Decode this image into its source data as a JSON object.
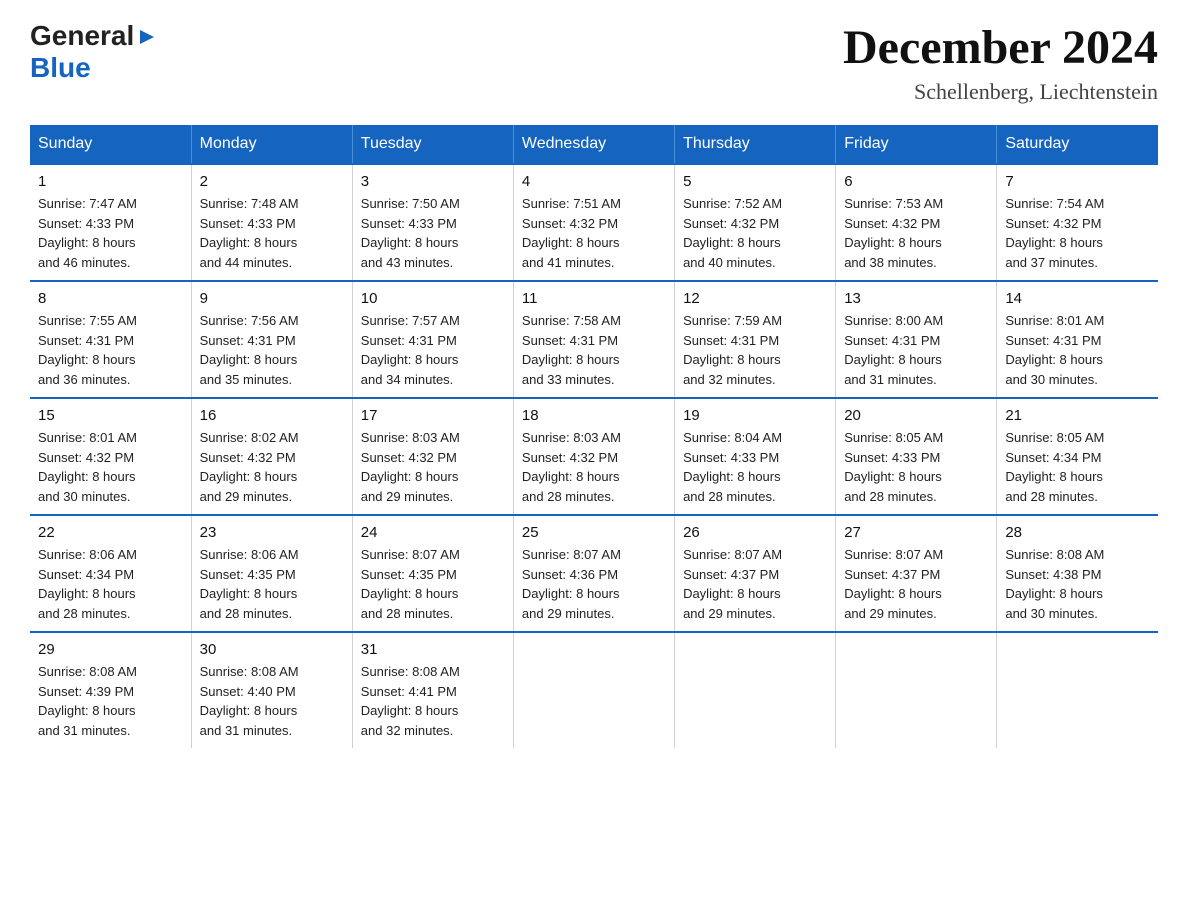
{
  "header": {
    "logo_general": "General",
    "logo_blue": "Blue",
    "month_title": "December 2024",
    "location": "Schellenberg, Liechtenstein"
  },
  "days_of_week": [
    "Sunday",
    "Monday",
    "Tuesday",
    "Wednesday",
    "Thursday",
    "Friday",
    "Saturday"
  ],
  "weeks": [
    [
      {
        "day": "1",
        "sunrise": "7:47 AM",
        "sunset": "4:33 PM",
        "daylight": "8 hours and 46 minutes."
      },
      {
        "day": "2",
        "sunrise": "7:48 AM",
        "sunset": "4:33 PM",
        "daylight": "8 hours and 44 minutes."
      },
      {
        "day": "3",
        "sunrise": "7:50 AM",
        "sunset": "4:33 PM",
        "daylight": "8 hours and 43 minutes."
      },
      {
        "day": "4",
        "sunrise": "7:51 AM",
        "sunset": "4:32 PM",
        "daylight": "8 hours and 41 minutes."
      },
      {
        "day": "5",
        "sunrise": "7:52 AM",
        "sunset": "4:32 PM",
        "daylight": "8 hours and 40 minutes."
      },
      {
        "day": "6",
        "sunrise": "7:53 AM",
        "sunset": "4:32 PM",
        "daylight": "8 hours and 38 minutes."
      },
      {
        "day": "7",
        "sunrise": "7:54 AM",
        "sunset": "4:32 PM",
        "daylight": "8 hours and 37 minutes."
      }
    ],
    [
      {
        "day": "8",
        "sunrise": "7:55 AM",
        "sunset": "4:31 PM",
        "daylight": "8 hours and 36 minutes."
      },
      {
        "day": "9",
        "sunrise": "7:56 AM",
        "sunset": "4:31 PM",
        "daylight": "8 hours and 35 minutes."
      },
      {
        "day": "10",
        "sunrise": "7:57 AM",
        "sunset": "4:31 PM",
        "daylight": "8 hours and 34 minutes."
      },
      {
        "day": "11",
        "sunrise": "7:58 AM",
        "sunset": "4:31 PM",
        "daylight": "8 hours and 33 minutes."
      },
      {
        "day": "12",
        "sunrise": "7:59 AM",
        "sunset": "4:31 PM",
        "daylight": "8 hours and 32 minutes."
      },
      {
        "day": "13",
        "sunrise": "8:00 AM",
        "sunset": "4:31 PM",
        "daylight": "8 hours and 31 minutes."
      },
      {
        "day": "14",
        "sunrise": "8:01 AM",
        "sunset": "4:31 PM",
        "daylight": "8 hours and 30 minutes."
      }
    ],
    [
      {
        "day": "15",
        "sunrise": "8:01 AM",
        "sunset": "4:32 PM",
        "daylight": "8 hours and 30 minutes."
      },
      {
        "day": "16",
        "sunrise": "8:02 AM",
        "sunset": "4:32 PM",
        "daylight": "8 hours and 29 minutes."
      },
      {
        "day": "17",
        "sunrise": "8:03 AM",
        "sunset": "4:32 PM",
        "daylight": "8 hours and 29 minutes."
      },
      {
        "day": "18",
        "sunrise": "8:03 AM",
        "sunset": "4:32 PM",
        "daylight": "8 hours and 28 minutes."
      },
      {
        "day": "19",
        "sunrise": "8:04 AM",
        "sunset": "4:33 PM",
        "daylight": "8 hours and 28 minutes."
      },
      {
        "day": "20",
        "sunrise": "8:05 AM",
        "sunset": "4:33 PM",
        "daylight": "8 hours and 28 minutes."
      },
      {
        "day": "21",
        "sunrise": "8:05 AM",
        "sunset": "4:34 PM",
        "daylight": "8 hours and 28 minutes."
      }
    ],
    [
      {
        "day": "22",
        "sunrise": "8:06 AM",
        "sunset": "4:34 PM",
        "daylight": "8 hours and 28 minutes."
      },
      {
        "day": "23",
        "sunrise": "8:06 AM",
        "sunset": "4:35 PM",
        "daylight": "8 hours and 28 minutes."
      },
      {
        "day": "24",
        "sunrise": "8:07 AM",
        "sunset": "4:35 PM",
        "daylight": "8 hours and 28 minutes."
      },
      {
        "day": "25",
        "sunrise": "8:07 AM",
        "sunset": "4:36 PM",
        "daylight": "8 hours and 29 minutes."
      },
      {
        "day": "26",
        "sunrise": "8:07 AM",
        "sunset": "4:37 PM",
        "daylight": "8 hours and 29 minutes."
      },
      {
        "day": "27",
        "sunrise": "8:07 AM",
        "sunset": "4:37 PM",
        "daylight": "8 hours and 29 minutes."
      },
      {
        "day": "28",
        "sunrise": "8:08 AM",
        "sunset": "4:38 PM",
        "daylight": "8 hours and 30 minutes."
      }
    ],
    [
      {
        "day": "29",
        "sunrise": "8:08 AM",
        "sunset": "4:39 PM",
        "daylight": "8 hours and 31 minutes."
      },
      {
        "day": "30",
        "sunrise": "8:08 AM",
        "sunset": "4:40 PM",
        "daylight": "8 hours and 31 minutes."
      },
      {
        "day": "31",
        "sunrise": "8:08 AM",
        "sunset": "4:41 PM",
        "daylight": "8 hours and 32 minutes."
      },
      null,
      null,
      null,
      null
    ]
  ],
  "labels": {
    "sunrise": "Sunrise:",
    "sunset": "Sunset:",
    "daylight": "Daylight:"
  }
}
